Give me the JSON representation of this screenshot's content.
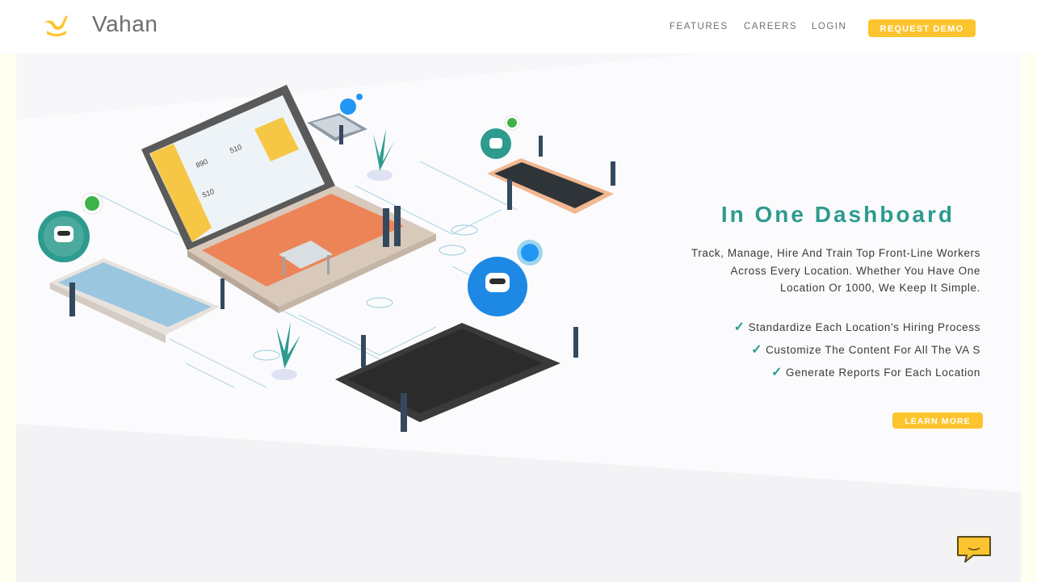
{
  "header": {
    "brand": "Vahan",
    "nav": [
      "FEATURES",
      "CAREERS",
      "LOGIN"
    ],
    "cta": "REQUEST DEMO"
  },
  "hero": {
    "title": "In One Dashboard",
    "description_lines": [
      "Track, Manage, Hire And Train Top Front-Line Workers",
      "Across Every Location. Whether You Have One",
      "Location Or 1000, We Keep It Simple."
    ],
    "features": [
      "Standardize Each Location's Hiring Process",
      "Customize The Content For All The VA S",
      "Generate Reports For Each Location"
    ],
    "learn_more": "LEARN MORE",
    "check_icon": "✓"
  },
  "illustration": {
    "dashboard_values": [
      "890",
      "510",
      "510"
    ]
  },
  "colors": {
    "accent": "#fcc42e",
    "teal": "#2d9b8e",
    "text": "#3a3a3a"
  }
}
